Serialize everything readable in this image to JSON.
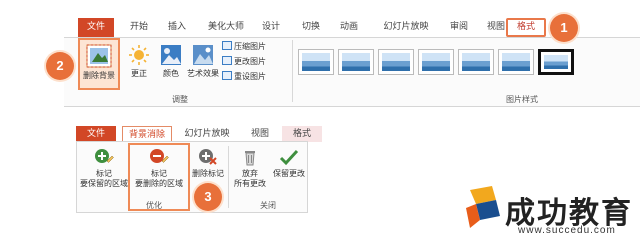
{
  "ribbon1": {
    "tabs": [
      "文件",
      "开始",
      "插入",
      "美化大师",
      "设计",
      "切换",
      "动画",
      "幻灯片放映",
      "审阅",
      "视图",
      "格式"
    ],
    "remove_background": "删除背景",
    "corrections": "更正",
    "color": "颜色",
    "artistic_effects": "艺术效果",
    "compress": "压缩图片",
    "change_picture": "更改图片",
    "reset_picture": "重设图片",
    "adjust_group": "调整",
    "styles_group": "图片样式"
  },
  "ribbon2": {
    "tabs": [
      "文件",
      "背景消除",
      "幻灯片放映",
      "视图",
      "格式"
    ],
    "mark_keep": [
      "标记",
      "要保留的区域"
    ],
    "mark_remove": [
      "标记",
      "要删除的区域"
    ],
    "delete_mark": "删除标记",
    "discard": [
      "放弃",
      "所有更改"
    ],
    "keep_changes": "保留更改",
    "refine_group": "优化",
    "close_group": "关闭"
  },
  "callouts": [
    "1",
    "2",
    "3"
  ],
  "watermark": {
    "brand": "成功教育",
    "url": "www.succedu.com"
  },
  "colors": {
    "accent": "#d24726",
    "highlight": "#ef8a56",
    "badge": "#e8703a"
  }
}
